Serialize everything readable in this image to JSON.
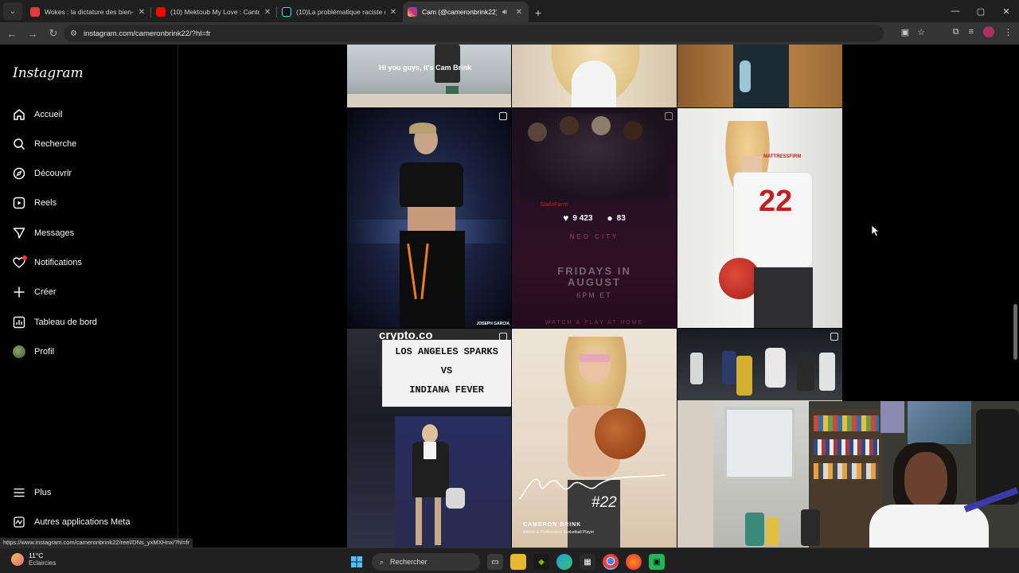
{
  "browser": {
    "tabs": [
      {
        "title": "Wokes : la dictature des bien-p",
        "favicon_color": "#e03a3a"
      },
      {
        "title": "(10) Mektoub My Love : Canto",
        "favicon_color": "#ff0000"
      },
      {
        "title": "(10)La problématique raciste da",
        "favicon_color": "#111111"
      },
      {
        "title": "Cam (@cameronbrink22) •",
        "favicon_color": "#d6249f"
      }
    ],
    "url": "instagram.com/cameronbrink22/?hl=fr"
  },
  "instagram": {
    "logo": "Instagram",
    "nav": [
      {
        "label": "Accueil",
        "icon": "home-icon"
      },
      {
        "label": "Recherche",
        "icon": "search-icon"
      },
      {
        "label": "Découvrir",
        "icon": "compass-icon"
      },
      {
        "label": "Reels",
        "icon": "reels-icon"
      },
      {
        "label": "Messages",
        "icon": "messages-icon"
      },
      {
        "label": "Notifications",
        "icon": "heart-icon"
      },
      {
        "label": "Créer",
        "icon": "plus-icon"
      },
      {
        "label": "Tableau de bord",
        "icon": "dashboard-icon"
      },
      {
        "label": "Profil",
        "icon": "avatar"
      }
    ],
    "nav_bottom": [
      {
        "label": "Plus",
        "icon": "menu-icon"
      },
      {
        "label": "Autres applications Meta",
        "icon": "meta-icon"
      }
    ],
    "posts": {
      "top_left_caption": "Hi you guys, it's Cam Brink",
      "middle_left_credit": "JOSEPH GARCIA",
      "middle_hover": {
        "likes": "9 423",
        "comments": "83"
      },
      "middle_center": {
        "brand": "StateFarm",
        "subtitle": "NEO CITY",
        "line1": "FRIDAYS IN",
        "line2": "AUGUST",
        "time": "6PM ET",
        "footer": "WATCH & PLAY AT HOME"
      },
      "middle_right_jersey": {
        "sponsor": "MATTRESSFIRM",
        "number": "22"
      },
      "bottom_left": {
        "logo": "crypto.co",
        "line1": "LOS ANGELES SPARKS",
        "line2": "VS",
        "line3": "INDIANA FEVER"
      },
      "bottom_center": {
        "number": "#22",
        "name": "CAMERON BRINK",
        "tagline": "Athlete & Professional Basketball Player"
      }
    }
  },
  "status_url": "https://www.instagram.com/cameronbrink22/reel/DNs_yxMXHnx/?hl=fr",
  "taskbar": {
    "temperature": "11°C",
    "weather": "Eclaircies",
    "search": "Rechercher"
  }
}
